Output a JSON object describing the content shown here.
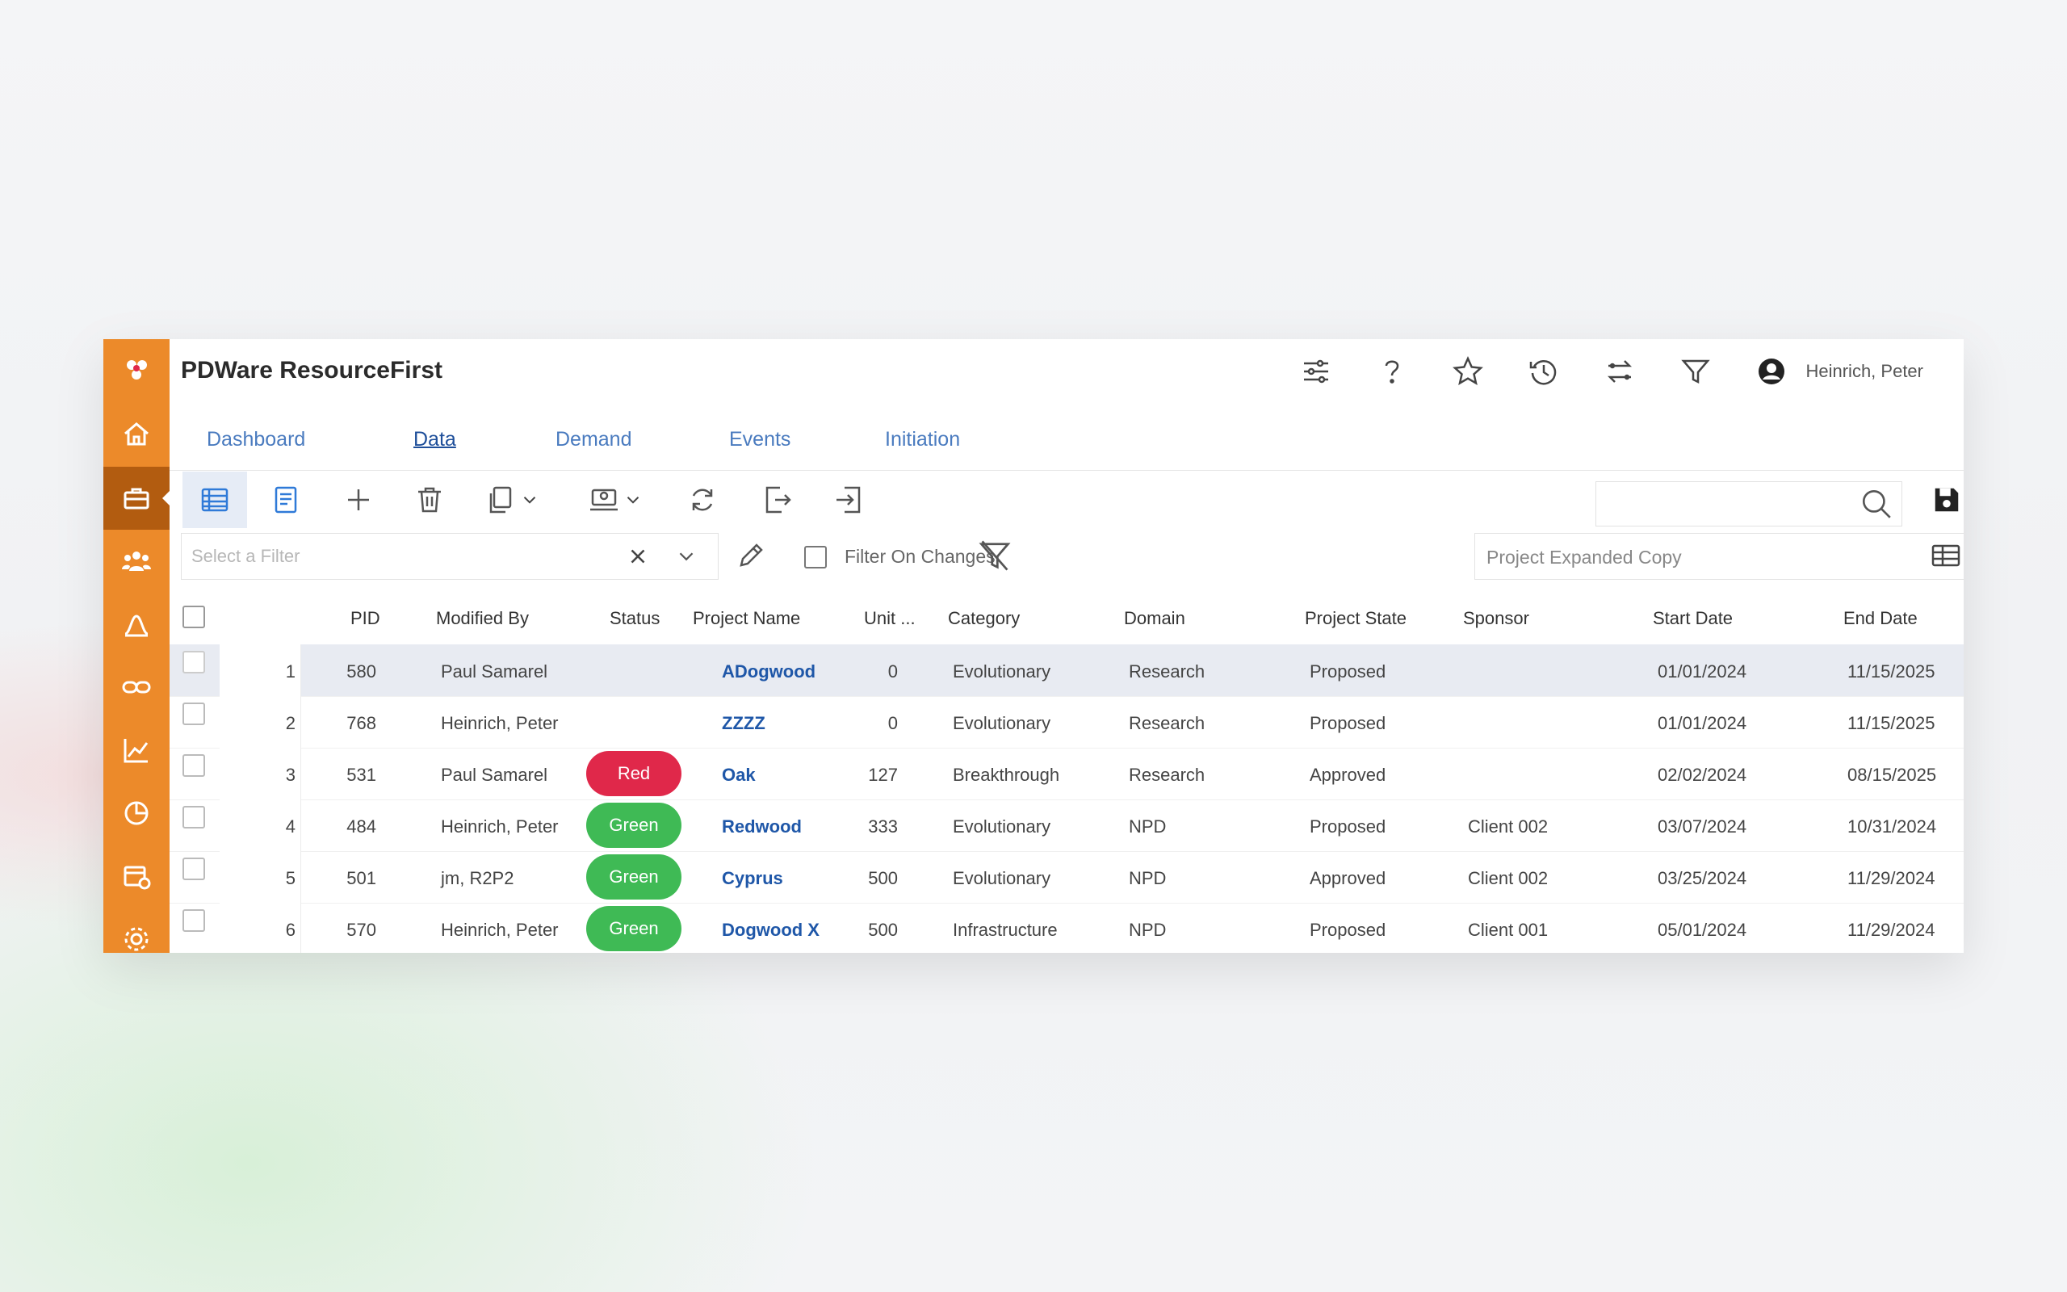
{
  "app": {
    "title": "PDWare ResourceFirst"
  },
  "colors": {
    "rail": "#ec8a2a",
    "rail_active": "#b25c10",
    "link": "#1f57a8",
    "status_red": "#e0284a",
    "status_green": "#3fba55"
  },
  "rail": {
    "items": [
      "logo-icon",
      "home-icon",
      "briefcase-icon",
      "people-icon",
      "curve-icon",
      "link-icon",
      "chart-icon",
      "pie-icon",
      "calendar-icon",
      "settings-icon"
    ]
  },
  "user": {
    "name": "Heinrich, Peter"
  },
  "tabs": [
    {
      "label": "Dashboard"
    },
    {
      "label": "Data"
    },
    {
      "label": "Demand"
    },
    {
      "label": "Events"
    },
    {
      "label": "Initiation"
    }
  ],
  "filter": {
    "placeholder": "Select a Filter",
    "filter_on_changes_label": "Filter On Changes"
  },
  "view": {
    "selected": "Project Expanded Copy"
  },
  "search": {
    "placeholder": ""
  },
  "table": {
    "columns": [
      "PID",
      "Modified By",
      "Status",
      "Project Name",
      "Unit ...",
      "Category",
      "Domain",
      "Project State",
      "Sponsor",
      "Start Date",
      "End Date"
    ],
    "rows": [
      {
        "idx": "1",
        "pid": "580",
        "modified_by": "Paul Samarel",
        "status": "",
        "project_name": "ADogwood",
        "unit": "0",
        "category": "Evolutionary",
        "domain": "Research",
        "state": "Proposed",
        "sponsor": "",
        "start": "01/01/2024",
        "end": "11/15/2025"
      },
      {
        "idx": "2",
        "pid": "768",
        "modified_by": "Heinrich, Peter",
        "status": "",
        "project_name": "ZZZZ",
        "unit": "0",
        "category": "Evolutionary",
        "domain": "Research",
        "state": "Proposed",
        "sponsor": "",
        "start": "01/01/2024",
        "end": "11/15/2025"
      },
      {
        "idx": "3",
        "pid": "531",
        "modified_by": "Paul Samarel",
        "status": "Red",
        "project_name": "Oak",
        "unit": "127",
        "category": "Breakthrough",
        "domain": "Research",
        "state": "Approved",
        "sponsor": "",
        "start": "02/02/2024",
        "end": "08/15/2025"
      },
      {
        "idx": "4",
        "pid": "484",
        "modified_by": "Heinrich, Peter",
        "status": "Green",
        "project_name": "Redwood",
        "unit": "333",
        "category": "Evolutionary",
        "domain": "NPD",
        "state": "Proposed",
        "sponsor": "Client 002",
        "start": "03/07/2024",
        "end": "10/31/2024"
      },
      {
        "idx": "5",
        "pid": "501",
        "modified_by": "jm, R2P2",
        "status": "Green",
        "project_name": "Cyprus",
        "unit": "500",
        "category": "Evolutionary",
        "domain": "NPD",
        "state": "Approved",
        "sponsor": "Client 002",
        "start": "03/25/2024",
        "end": "11/29/2024"
      },
      {
        "idx": "6",
        "pid": "570",
        "modified_by": "Heinrich, Peter",
        "status": "Green",
        "project_name": "Dogwood X",
        "unit": "500",
        "category": "Infrastructure",
        "domain": "NPD",
        "state": "Proposed",
        "sponsor": "Client 001",
        "start": "05/01/2024",
        "end": "11/29/2024"
      }
    ]
  }
}
